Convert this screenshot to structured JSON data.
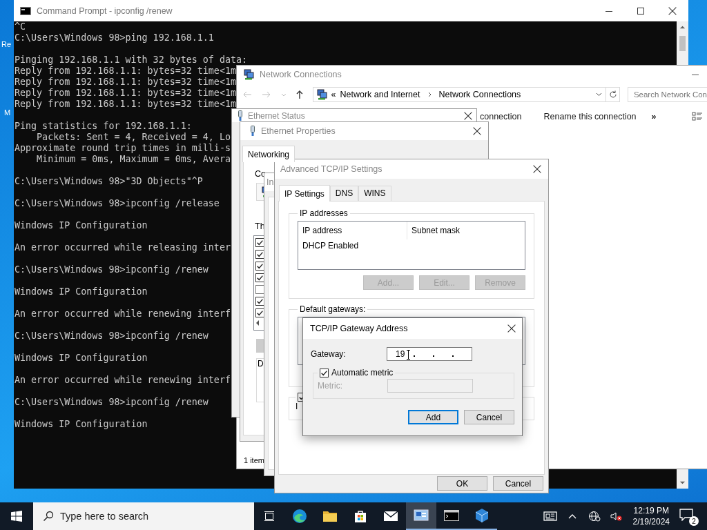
{
  "desktop_icons": [
    {
      "label": "Re"
    },
    {
      "label": "M"
    }
  ],
  "console": {
    "title": "Command Prompt - ipconfig  /renew",
    "blocks": [
      [
        "^C",
        "C:\\Users\\Windows 98>ping 192.168.1.1"
      ],
      [
        "Pinging 192.168.1.1 with 32 bytes of data:",
        "Reply from 192.168.1.1: bytes=32 time<1m",
        "Reply from 192.168.1.1: bytes=32 time<1m",
        "Reply from 192.168.1.1: bytes=32 time<1m",
        "Reply from 192.168.1.1: bytes=32 time<1m"
      ],
      [
        "Ping statistics for 192.168.1.1:",
        "    Packets: Sent = 4, Received = 4, Lo",
        "Approximate round trip times in milli-s",
        "    Minimum = 0ms, Maximum = 0ms, Avera"
      ],
      [
        "C:\\Users\\Windows 98>\"3D Objects\"^P"
      ],
      [
        "C:\\Users\\Windows 98>ipconfig /release"
      ],
      [
        "Windows IP Configuration"
      ],
      [
        "An error occurred while releasing inter"
      ],
      [
        "C:\\Users\\Windows 98>ipconfig /renew"
      ],
      [
        "Windows IP Configuration"
      ],
      [
        "An error occurred while renewing interf"
      ],
      [
        "C:\\Users\\Windows 98>ipconfig /renew"
      ],
      [
        "Windows IP Configuration"
      ],
      [
        "An error occurred while renewing interf"
      ],
      [
        "C:\\Users\\Windows 98>ipconfig /renew"
      ],
      [
        "Windows IP Configuration"
      ]
    ]
  },
  "network_connections": {
    "title": "Network Connections",
    "path_overflow": "«",
    "breadcrumb": [
      "Network and Internet",
      "Network Connections"
    ],
    "search": {
      "placeholder": "Search Network Con"
    },
    "toolbar": [
      "connection",
      "Rename this connection"
    ],
    "toolbar_more": "»",
    "status_bar": "1 item"
  },
  "ethernet_status": {
    "title": "Ethernet Status"
  },
  "ethernet_properties": {
    "title": "Ethernet Properties",
    "tabs": [
      {
        "label": "Networking",
        "selected": true
      }
    ],
    "connect_label": "Co",
    "items_label": "Th",
    "items": [
      {
        "checked": true
      },
      {
        "checked": true
      },
      {
        "checked": true
      },
      {
        "checked": true
      },
      {
        "checked": false
      },
      {
        "checked": true
      },
      {
        "checked": true
      }
    ],
    "description_label": "D"
  },
  "ipv4_properties": {
    "title": "In"
  },
  "advanced": {
    "title": "Advanced TCP/IP Settings",
    "tabs": [
      {
        "label": "IP Settings",
        "selected": true
      },
      {
        "label": "DNS",
        "selected": false
      },
      {
        "label": "WINS",
        "selected": false
      }
    ],
    "ip_group": "IP addresses",
    "ip_columns": [
      "IP address",
      "Subnet mask"
    ],
    "ip_rows": [
      [
        "DHCP Enabled"
      ]
    ],
    "ip_buttons": [
      {
        "label": "Add...",
        "disabled": true
      },
      {
        "label": "Edit...",
        "disabled": true
      },
      {
        "label": "Remove",
        "disabled": true
      }
    ],
    "gateway_group": "Default gateways:",
    "automatic_metric": {
      "checked": true
    },
    "interface_metric_label": "I",
    "buttons": [
      {
        "label": "OK"
      },
      {
        "label": "Cancel"
      }
    ]
  },
  "gateway_dialog": {
    "title": "TCP/IP Gateway Address",
    "gateway_label": "Gateway:",
    "gateway_value": "19",
    "automatic_metric": {
      "label": "Automatic metric",
      "checked": true
    },
    "metric_label": "Metric:",
    "metric_disabled": true,
    "buttons": [
      {
        "label": "Add",
        "default": true
      },
      {
        "label": "Cancel",
        "default": false
      }
    ]
  },
  "taskbar": {
    "search_placeholder": "Type here to search",
    "apps": [
      {
        "kind": "task-view",
        "running": false,
        "active": false
      },
      {
        "kind": "browser",
        "running": false,
        "active": false
      },
      {
        "kind": "folder",
        "running": false,
        "active": false
      },
      {
        "kind": "store",
        "running": false,
        "active": false
      },
      {
        "kind": "mail",
        "running": false,
        "active": false
      },
      {
        "kind": "network",
        "running": true,
        "active": true
      },
      {
        "kind": "terminal",
        "running": true,
        "active": false
      },
      {
        "kind": "cube",
        "running": true,
        "active": false
      }
    ],
    "time": "12:19 PM",
    "date": "2/19/2024",
    "notification_count": "2"
  }
}
